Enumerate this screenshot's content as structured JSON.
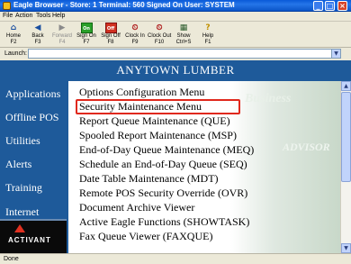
{
  "window": {
    "title": "Eagle Browser  -  Store: 1    Terminal: 560    Signed On User: SYSTEM",
    "controls": [
      "_",
      "□",
      "×"
    ]
  },
  "menu": [
    "File",
    "Action",
    "Tools",
    "Help"
  ],
  "toolbar": [
    {
      "label": "Home",
      "key": "F2",
      "icon": "home-icon",
      "glyph": "⌂",
      "enabled": true
    },
    {
      "label": "Back",
      "key": "F3",
      "icon": "back-arrow-icon",
      "glyph": "◀",
      "enabled": true
    },
    {
      "label": "Forward",
      "key": "F4",
      "icon": "forward-arrow-icon",
      "glyph": "▶",
      "enabled": false
    },
    {
      "label": "Sign On",
      "key": "F7",
      "icon": "sign-on-icon",
      "glyph": "On",
      "enabled": true
    },
    {
      "label": "Sign Off",
      "key": "F8",
      "icon": "sign-off-icon",
      "glyph": "Off",
      "enabled": true
    },
    {
      "label": "Clock In",
      "key": "F9",
      "icon": "clock-in-icon",
      "glyph": "⏲",
      "enabled": true
    },
    {
      "label": "Clock Out",
      "key": "F10",
      "icon": "clock-out-icon",
      "glyph": "⏲",
      "enabled": true
    },
    {
      "label": "Show",
      "key": "Ctrl+S",
      "icon": "show-icon",
      "glyph": "▦",
      "enabled": true
    },
    {
      "label": "Help",
      "key": "F1",
      "icon": "help-icon",
      "glyph": "?",
      "enabled": true
    }
  ],
  "launch": {
    "label": "Launch:",
    "value": ""
  },
  "banner": "ANYTOWN LUMBER",
  "sidebar": [
    "Applications",
    "Offline POS",
    "Utilities",
    "Alerts",
    "Training",
    "Internet Training"
  ],
  "logo": "ACTIVANT",
  "watermark": [
    "Business",
    "ADVISOR"
  ],
  "menu_items": [
    "Options Configuration Menu",
    "Security Maintenance Menu",
    "Report Queue Maintenance (QUE)",
    "Spooled Report Maintenance (MSP)",
    "End-of-Day Queue Maintenance (MEQ)",
    "Schedule an End-of-Day Queue (SEQ)",
    "Date Table Maintenance (MDT)",
    "Remote POS Security Override (OVR)",
    "Document Archive Viewer",
    "Active Eagle Functions (SHOWTASK)",
    "Fax Queue Viewer (FAXQUE)"
  ],
  "highlighted_item": "Security Maintenance Menu",
  "colors": {
    "accent": "#1e5a9a",
    "highlight": "#e0281c"
  },
  "status": "Done"
}
